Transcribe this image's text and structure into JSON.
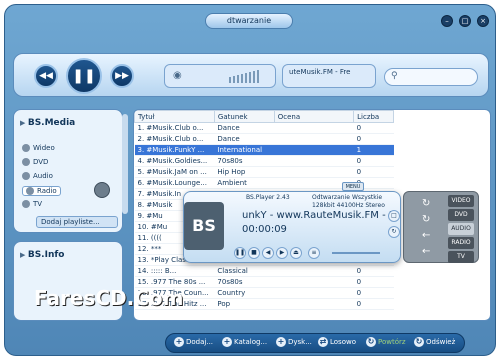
{
  "window": {
    "title": "dtwarzanie"
  },
  "stream": {
    "station": "uteMusik.FM - Fre"
  },
  "left_panel": {
    "title": "BS.Media",
    "items": [
      {
        "label": "Wideo"
      },
      {
        "label": "DVD"
      },
      {
        "label": "Audio"
      },
      {
        "label": "Radio"
      },
      {
        "label": "TV"
      }
    ],
    "add_playlist": "Dodaj playliste..."
  },
  "info_panel": {
    "title": "BS.Info"
  },
  "table": {
    "headers": [
      "Tytuł",
      "Gatunek",
      "Ocena",
      "Liczba"
    ],
    "rows": [
      [
        "1. #Musik.Club o...",
        "Dance",
        "",
        "0"
      ],
      [
        "2. #Musik.Club o...",
        "Dance",
        "",
        "0"
      ],
      [
        "3. #Musik.FunkY ...",
        "International",
        "",
        "1"
      ],
      [
        "4. #Musik.Goldies...",
        "70s80s",
        "",
        "0"
      ],
      [
        "5. #Musik.JaM on ...",
        "Hip Hop",
        "",
        "0"
      ],
      [
        "6. #Musik.Lounge...",
        "Ambient",
        "",
        "0"
      ],
      [
        "7. #Musik.In",
        "",
        "",
        "0"
      ],
      [
        "8. #Musik",
        "",
        "",
        "0"
      ],
      [
        "9. #Mu",
        "",
        "",
        "0"
      ],
      [
        "10. #Mu",
        "",
        "",
        "0"
      ],
      [
        "11. ((((",
        "",
        "",
        "0"
      ],
      [
        "12. ***",
        "",
        "",
        "0"
      ],
      [
        "13. *Play Classic...",
        "Classical",
        "",
        "0"
      ],
      [
        "14. ::::: B...",
        "Classical",
        "",
        "0"
      ],
      [
        "15. .977 The 80s ...",
        "70s80s",
        "",
        "0"
      ],
      [
        "16. .977 The Coun...",
        "Country",
        "",
        "0"
      ],
      [
        "17. .977 The Hitz ...",
        "Pop",
        "",
        "0"
      ]
    ]
  },
  "bsplayer": {
    "name": "BS.Player 2.43",
    "mode_label": "Odtwarzanie",
    "scope_label": "Wszystkie",
    "format": "128kbit 44100Hz Stereo",
    "logo": "BS",
    "song": "unkY - www.RauteMusik.FM - Fr",
    "time": "00:00:09",
    "menu": "MENU",
    "modes": [
      "VIDEO",
      "DVD",
      "AUDIO",
      "RADIO",
      "TV"
    ]
  },
  "bottom_bar": {
    "buttons": [
      {
        "label": "Dodaj..."
      },
      {
        "label": "Katalog..."
      },
      {
        "label": "Dysk..."
      },
      {
        "label": "Losowo"
      },
      {
        "label": "Powtórz"
      },
      {
        "label": "Odśwież"
      }
    ]
  },
  "watermark": "FaresCD.Com",
  "colors": {
    "accent": "#4f86b6",
    "selection": "#3875d7",
    "dark_blue": "#0e3866"
  }
}
